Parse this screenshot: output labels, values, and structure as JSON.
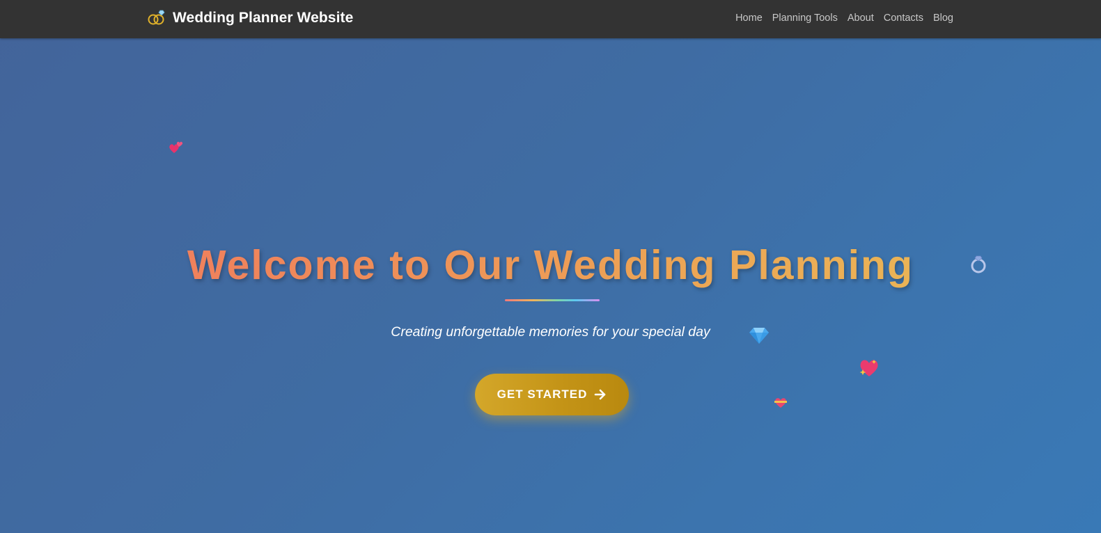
{
  "navbar": {
    "brand_icon": "wedding-rings-icon",
    "brand_title": "Wedding Planner Website",
    "links": [
      {
        "label": "Home"
      },
      {
        "label": "Planning Tools"
      },
      {
        "label": "About"
      },
      {
        "label": "Contacts"
      },
      {
        "label": "Blog"
      }
    ]
  },
  "hero": {
    "title": "Welcome to Our Wedding Planning",
    "subtitle": "Creating unforgettable memories for your special day",
    "cta_label": "GET STARTED",
    "cta_icon": "arrow-right-icon"
  },
  "decorations": [
    {
      "icon": "two-hearts-icon"
    },
    {
      "icon": "ring-icon"
    },
    {
      "icon": "gem-icon"
    },
    {
      "icon": "sparkling-heart-icon"
    },
    {
      "icon": "heart-with-ribbon-icon"
    }
  ],
  "colors": {
    "navbar_bg": "#333333",
    "hero_bg_start": "#43649a",
    "hero_bg_end": "#3979b6",
    "title_gradient_start": "#f07560",
    "title_gradient_end": "#e9bf57",
    "cta_bg": "#c49417",
    "nav_link": "#c8c8c8"
  }
}
